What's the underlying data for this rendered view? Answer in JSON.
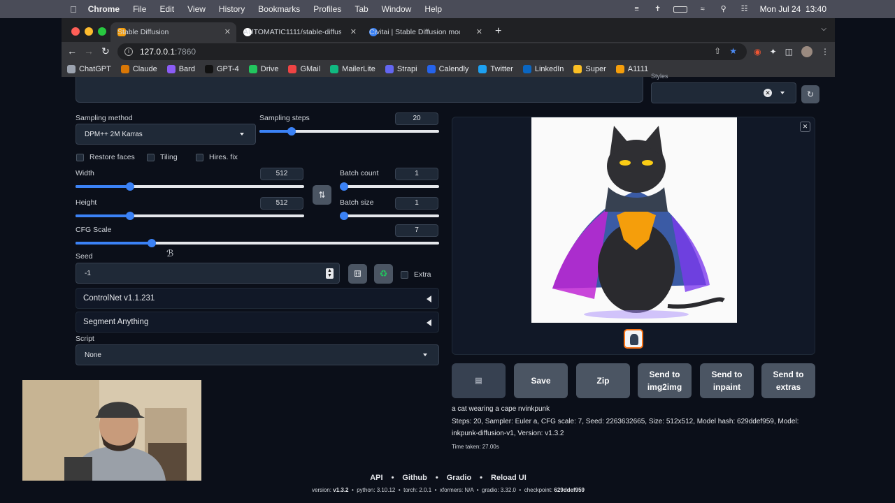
{
  "menubar": {
    "app": "Chrome",
    "items": [
      "File",
      "Edit",
      "View",
      "History",
      "Bookmarks",
      "Profiles",
      "Tab",
      "Window",
      "Help"
    ],
    "clock": "Mon Jul 24  13:40"
  },
  "tabs": [
    {
      "title": "Stable Diffusion",
      "color": "#f59e0b"
    },
    {
      "title": "AUTOMATIC1111/stable-diffusi",
      "color": "#ffffff"
    },
    {
      "title": "Civitai | Stable Diffusion model",
      "color": "#3b82f6"
    }
  ],
  "url": {
    "host": "127.0.0.1",
    "port": ":7860"
  },
  "bookmarks": [
    {
      "label": "ChatGPT",
      "color": "#9ca3af"
    },
    {
      "label": "Claude",
      "color": "#d97706"
    },
    {
      "label": "Bard",
      "color": "#8b5cf6"
    },
    {
      "label": "GPT-4",
      "color": "#111111"
    },
    {
      "label": "Drive",
      "color": "#22c55e"
    },
    {
      "label": "GMail",
      "color": "#ef4444"
    },
    {
      "label": "MailerLite",
      "color": "#10b981"
    },
    {
      "label": "Strapi",
      "color": "#6366f1"
    },
    {
      "label": "Calendly",
      "color": "#2563eb"
    },
    {
      "label": "Twitter",
      "color": "#1da1f2"
    },
    {
      "label": "LinkedIn",
      "color": "#0a66c2"
    },
    {
      "label": "Super",
      "color": "#fbbf24"
    },
    {
      "label": "A1111",
      "color": "#f59e0b"
    }
  ],
  "styles_label": "Styles",
  "sampling_method": {
    "label": "Sampling method",
    "value": "DPM++ 2M Karras"
  },
  "sampling_steps": {
    "label": "Sampling steps",
    "value": "20",
    "fraction": 0.18
  },
  "checkboxes": {
    "restore_faces": "Restore faces",
    "tiling": "Tiling",
    "hires_fix": "Hires. fix"
  },
  "width": {
    "label": "Width",
    "value": "512",
    "fraction": 0.24
  },
  "height": {
    "label": "Height",
    "value": "512",
    "fraction": 0.24
  },
  "batch_count": {
    "label": "Batch count",
    "value": "1",
    "fraction": 0.0
  },
  "batch_size": {
    "label": "Batch size",
    "value": "1",
    "fraction": 0.0
  },
  "cfg_scale": {
    "label": "CFG Scale",
    "value": "7",
    "fraction": 0.21
  },
  "seed": {
    "label": "Seed",
    "value": "-1",
    "extra": "Extra"
  },
  "controlnet": "ControlNet v1.1.231",
  "segment_anything": "Segment Anything",
  "script": {
    "label": "Script",
    "value": "None"
  },
  "actions": {
    "save": "Save",
    "zip": "Zip",
    "img2img": "Send to img2img",
    "inpaint": "Send to inpaint",
    "extras": "Send to extras"
  },
  "output": {
    "prompt": "a cat wearing a cape nvinkpunk",
    "params": "Steps: 20, Sampler: Euler a, CFG scale: 7, Seed: 2263632665, Size: 512x512, Model hash: 629ddef959, Model: inkpunk-diffusion-v1, Version: v1.3.2",
    "time": "Time taken: 27.00s"
  },
  "footer": {
    "links": [
      "API",
      "Github",
      "Gradio",
      "Reload UI"
    ],
    "version_label": "version:",
    "version": "v1.3.2",
    "python_label": "python:",
    "python": "3.10.12",
    "torch_label": "torch:",
    "torch": "2.0.1",
    "xformers_label": "xformers:",
    "xformers": "N/A",
    "gradio_label": "gradio:",
    "gradio": "3.32.0",
    "checkpoint_label": "checkpoint:",
    "checkpoint": "629ddef959"
  },
  "colors": {
    "accent": "#3b82f6",
    "panel": "#111827",
    "background": "#0b0f19"
  }
}
